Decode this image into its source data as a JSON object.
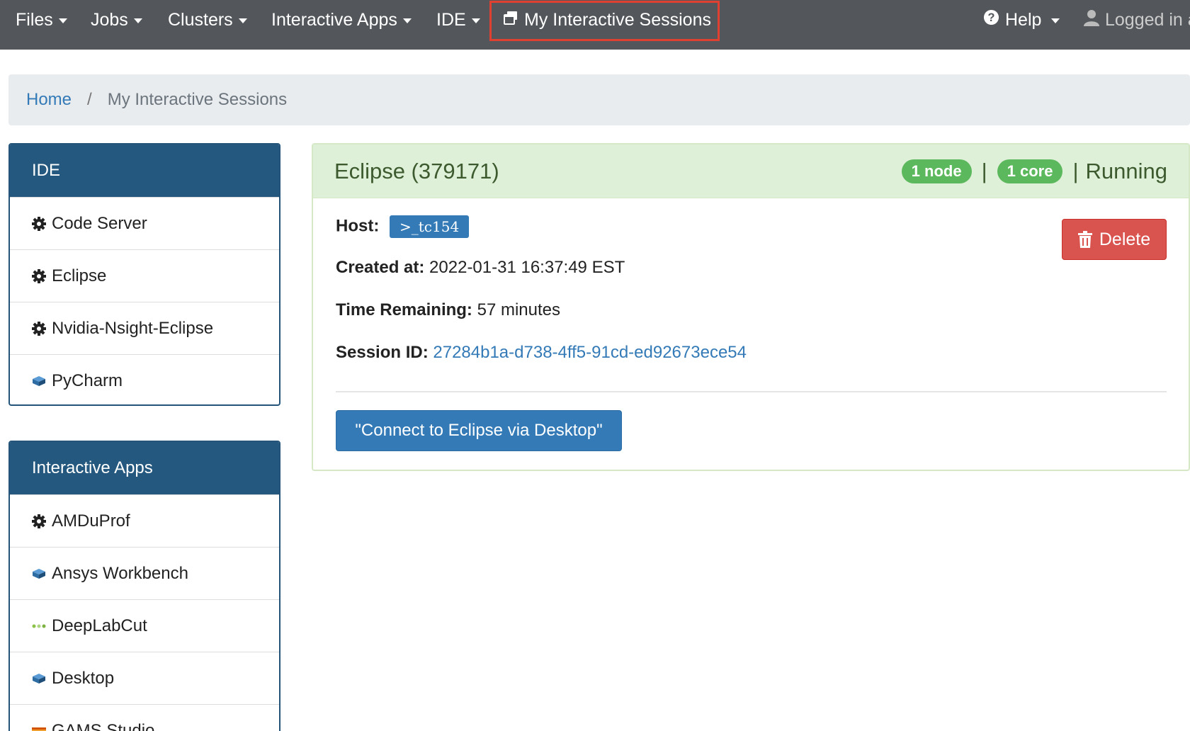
{
  "navbar": {
    "items": [
      {
        "label": "Files"
      },
      {
        "label": "Jobs"
      },
      {
        "label": "Clusters"
      },
      {
        "label": "Interactive Apps"
      },
      {
        "label": "IDE"
      },
      {
        "label": "My Interactive Sessions"
      },
      {
        "label": "Help"
      },
      {
        "label": "Logged in a"
      }
    ]
  },
  "breadcrumb": {
    "home": "Home",
    "separator": "/",
    "current": "My Interactive Sessions"
  },
  "sidebar": {
    "ide": {
      "heading": "IDE",
      "items": [
        {
          "label": "Code Server",
          "icon": "gear-icon"
        },
        {
          "label": "Eclipse",
          "icon": "gear-icon"
        },
        {
          "label": "Nvidia-Nsight-Eclipse",
          "icon": "gear-icon"
        },
        {
          "label": "PyCharm",
          "icon": "app-icon"
        }
      ]
    },
    "apps": {
      "heading": "Interactive Apps",
      "items": [
        {
          "label": "AMDuProf",
          "icon": "gear-icon"
        },
        {
          "label": "Ansys Workbench",
          "icon": "app-icon"
        },
        {
          "label": "DeepLabCut",
          "icon": "dlc-icon"
        },
        {
          "label": "Desktop",
          "icon": "app-icon"
        },
        {
          "label": "GAMS Studio",
          "icon": "gams-icon"
        }
      ]
    }
  },
  "session": {
    "title": "Eclipse (379171)",
    "nodes": "1 node",
    "cores": "1 core",
    "divider": "|",
    "status": "Running",
    "host_label": "Host:",
    "host_value": ">_tc154",
    "created_label": "Created at:",
    "created_value": "2022-01-31 16:37:49 EST",
    "remaining_label": "Time Remaining:",
    "remaining_value": "57 minutes",
    "session_id_label": "Session ID:",
    "session_id_value": "27284b1a-d738-4ff5-91cd-ed92673ece54",
    "delete_label": "Delete",
    "connect_label": "\"Connect to Eclipse via Desktop\""
  },
  "colors": {
    "navbar": "#53575b",
    "active_outline": "#e0402f",
    "panel_heading": "#24587e",
    "card_header": "#dff0d8",
    "success": "#5cb85c",
    "danger": "#d9534f",
    "primary": "#337ab7"
  }
}
